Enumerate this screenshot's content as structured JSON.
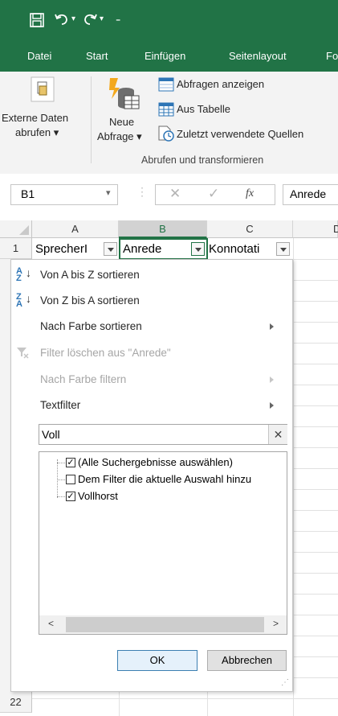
{
  "app": {
    "accent": "#217346"
  },
  "ribbon_tabs": [
    "Datei",
    "Start",
    "Einfügen",
    "Seitenlayout",
    "Fo"
  ],
  "ribbon": {
    "externe_daten_line1": "Externe Daten",
    "externe_daten_line2": "abrufen ▾",
    "neue_abfrage_line1": "Neue",
    "neue_abfrage_line2": "Abfrage ▾",
    "abfragen_anzeigen": "Abfragen anzeigen",
    "aus_tabelle": "Aus Tabelle",
    "zuletzt_quellen": "Zuletzt verwendete Quellen",
    "group_label": "Abrufen und transformieren"
  },
  "formula_bar": {
    "name_box": "B1",
    "fx_label": "fx",
    "formula_value": "Anrede"
  },
  "columns": [
    "A",
    "B",
    "C",
    "D"
  ],
  "rows": {
    "first": "1",
    "last": "22"
  },
  "cells": {
    "a1": "SprecherI",
    "b1": "Anrede",
    "c1": "Konnotati"
  },
  "filter_menu": {
    "sort_az": "Von A bis Z sortieren",
    "sort_za": "Von Z bis A sortieren",
    "sort_color": "Nach Farbe sortieren",
    "clear_filter": "Filter löschen aus \"Anrede\"",
    "filter_color": "Nach Farbe filtern",
    "text_filter": "Textfilter",
    "search_value": "Voll",
    "items": [
      {
        "label": "(Alle Suchergebnisse auswählen)",
        "checked": true
      },
      {
        "label": "Dem Filter die aktuelle Auswahl hinzu",
        "checked": false
      },
      {
        "label": "Vollhorst",
        "checked": true
      }
    ],
    "ok": "OK",
    "cancel": "Abbrechen"
  }
}
